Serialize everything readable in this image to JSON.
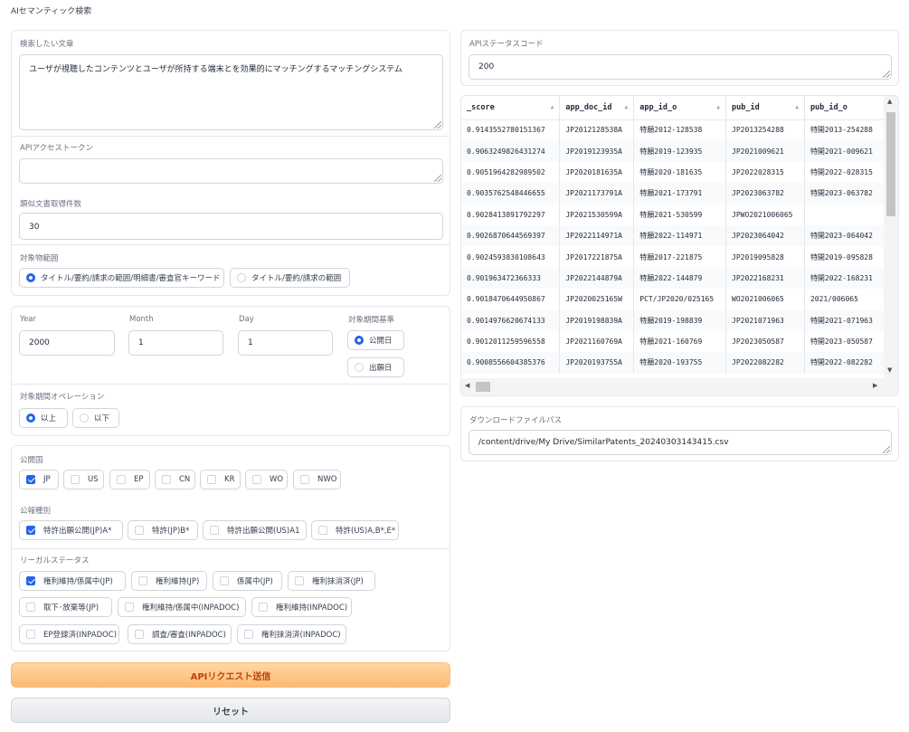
{
  "app_title": "AIセマンティック検索",
  "query": {
    "label": "検索したい文章",
    "value": "ユーザが視聴したコンテンツとユーザが所持する端末とを効果的にマッチングするマッチングシステム"
  },
  "token": {
    "label": "APIアクセストークン",
    "value": ""
  },
  "count": {
    "label": "類似文書取得件数",
    "value": "30"
  },
  "target": {
    "label": "対象物範囲",
    "options": [
      "タイトル/要約/請求の範囲/明細書/審査官キーワード",
      "タイトル/要約/請求の範囲"
    ],
    "selected": 0
  },
  "date": {
    "year_label": "Year",
    "year": "2000",
    "month_label": "Month",
    "month": "1",
    "day_label": "Day",
    "day": "1",
    "basis_label": "対象期間基準",
    "basis_options": [
      "公開日",
      "出願日"
    ],
    "basis_selected": 0,
    "op_label": "対象期間オペレーション",
    "op_options": [
      "以上",
      "以下"
    ],
    "op_selected": 0
  },
  "country": {
    "label": "公開国",
    "options": [
      "JP",
      "US",
      "EP",
      "CN",
      "KR",
      "WO",
      "NWO"
    ],
    "checked": [
      true,
      false,
      false,
      false,
      false,
      false,
      false
    ]
  },
  "kind": {
    "label": "公報種別",
    "options": [
      "特許出願公開(JP)A*",
      "特許(JP)B*",
      "特許出願公開(US)A1",
      "特許(US)A,B*,E*"
    ],
    "checked": [
      true,
      false,
      false,
      false
    ]
  },
  "legal": {
    "label": "リーガルステータス",
    "options": [
      "権利維持/係属中(JP)",
      "権利維持(JP)",
      "係属中(JP)",
      "権利抹消済(JP)",
      "取下･放棄等(JP)",
      "権利維持/係属中(INPADOC)",
      "権利維持(INPADOC)",
      "EP登録済(INPADOC)",
      "調査/審査(INPADOC)",
      "権利抹消済(INPADOC)"
    ],
    "checked": [
      true,
      false,
      false,
      false,
      false,
      false,
      false,
      false,
      false,
      false
    ]
  },
  "buttons": {
    "submit": "APIリクエスト送信",
    "reset": "リセット"
  },
  "status": {
    "label": "APIステータスコード",
    "value": "200"
  },
  "results": {
    "columns": [
      "_score",
      "app_doc_id",
      "app_id_o",
      "pub_id",
      "pub_id_o"
    ],
    "rows": [
      [
        "0.9143552780151367",
        "JP2012128538A",
        "特願2012-128538",
        "JP2013254288",
        "特開2013-254288"
      ],
      [
        "0.9063249826431274",
        "JP2019123935A",
        "特願2019-123935",
        "JP2021009621",
        "特開2021-009621"
      ],
      [
        "0.9051964282989502",
        "JP2020181635A",
        "特願2020-181635",
        "JP2022028315",
        "特開2022-028315"
      ],
      [
        "0.9035762548446655",
        "JP2021173791A",
        "特願2021-173791",
        "JP2023063782",
        "特開2023-063782"
      ],
      [
        "0.9028413891792297",
        "JP2021530599A",
        "特願2021-530599",
        "JPWO2021006065",
        ""
      ],
      [
        "0.9026870644569397",
        "JP2022114971A",
        "特願2022-114971",
        "JP2023064042",
        "特開2023-064042"
      ],
      [
        "0.9024593830108643",
        "JP2017221875A",
        "特願2017-221875",
        "JP2019095828",
        "特開2019-095828"
      ],
      [
        "0.901963472366333",
        "JP2022144879A",
        "特願2022-144879",
        "JP2022168231",
        "特開2022-168231"
      ],
      [
        "0.9018470644950867",
        "JP2020025165W",
        "PCT/JP2020/025165",
        "WO2021006065",
        "2021/006065"
      ],
      [
        "0.9014976620674133",
        "JP2019198839A",
        "特願2019-198839",
        "JP2021071963",
        "特開2021-071963"
      ],
      [
        "0.9012011259596558",
        "JP2021160769A",
        "特願2021-160769",
        "JP2023050587",
        "特開2023-050587"
      ],
      [
        "0.9008556604385376",
        "JP2020193755A",
        "特願2020-193755",
        "JP2022082282",
        "特開2022-082282"
      ]
    ]
  },
  "download": {
    "label": "ダウンロードファイルパス",
    "value": "/content/drive/My Drive/SimilarPatents_20240303143415.csv"
  }
}
